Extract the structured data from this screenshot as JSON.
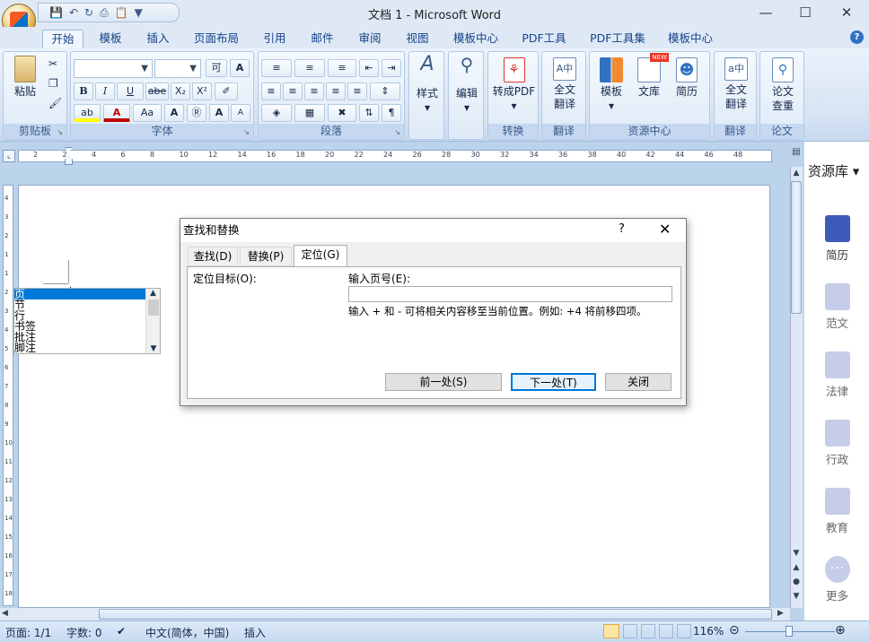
{
  "window": {
    "title": "文档 1 - Microsoft Word"
  },
  "tabs": [
    "开始",
    "模板",
    "插入",
    "页面布局",
    "引用",
    "邮件",
    "审阅",
    "视图",
    "模板中心",
    "PDF工具",
    "PDF工具集",
    "模板中心"
  ],
  "ribbon": {
    "clipboard": {
      "paste": "粘贴",
      "label": "剪贴板"
    },
    "font": {
      "label": "字体",
      "bold": "B",
      "italic": "I",
      "underline": "U",
      "strike": "abe",
      "sub": "X₂",
      "sup": "X²",
      "grow": "A",
      "shrink": "A"
    },
    "paragraph": {
      "label": "段落"
    },
    "styles": {
      "label": "样式"
    },
    "edit": {
      "label": "编辑"
    },
    "convert": {
      "btn": "转成PDF",
      "label": "转换"
    },
    "translate1": {
      "btn1": "全文",
      "btn2": "翻译",
      "label": "翻译"
    },
    "resources": {
      "template": "模板",
      "library": "文库",
      "resume": "简历",
      "label": "资源中心",
      "new_badge": "NEW"
    },
    "translate2": {
      "btn1": "全文",
      "btn2": "翻译",
      "label": "翻译"
    },
    "paper": {
      "btn1": "论文",
      "btn2": "查重",
      "label": "论文"
    }
  },
  "side_panel": {
    "title": "资源库",
    "items": [
      "简历",
      "范文",
      "法律",
      "行政",
      "教育",
      "更多"
    ],
    "colors": {
      "active": "#3c5ab7",
      "inactive": "#c5cde8"
    }
  },
  "ruler": {
    "ticks": [
      "2",
      "2",
      "4",
      "6",
      "8",
      "10",
      "12",
      "14",
      "16",
      "18",
      "20",
      "22",
      "24",
      "26",
      "28",
      "30",
      "32",
      "34",
      "36",
      "38",
      "40",
      "42",
      "44",
      "46",
      "48"
    ],
    "vticks": [
      "4",
      "3",
      "2",
      "1",
      "1",
      "2",
      "3",
      "4",
      "5",
      "6",
      "7",
      "8",
      "9",
      "10",
      "11",
      "12",
      "13",
      "14",
      "15",
      "16",
      "17",
      "18"
    ]
  },
  "status": {
    "page": "页面: 1/1",
    "words": "字数: 0",
    "lang": "中文(简体，中国)",
    "mode": "插入",
    "zoom": "116%"
  },
  "dialog": {
    "title": "查找和替换",
    "help": "?",
    "tabs": [
      "查找(D)",
      "替换(P)",
      "定位(G)"
    ],
    "target_label": "定位目标(O):",
    "targets": [
      "页",
      "节",
      "行",
      "书签",
      "批注",
      "脚注"
    ],
    "selected_target": "页",
    "page_label": "输入页号(E):",
    "page_value": "",
    "hint": "输入 + 和 - 可将相关内容移至当前位置。例如: +4 将前移四项。",
    "buttons": {
      "prev": "前一处(S)",
      "next": "下一处(T)",
      "close": "关闭"
    }
  }
}
